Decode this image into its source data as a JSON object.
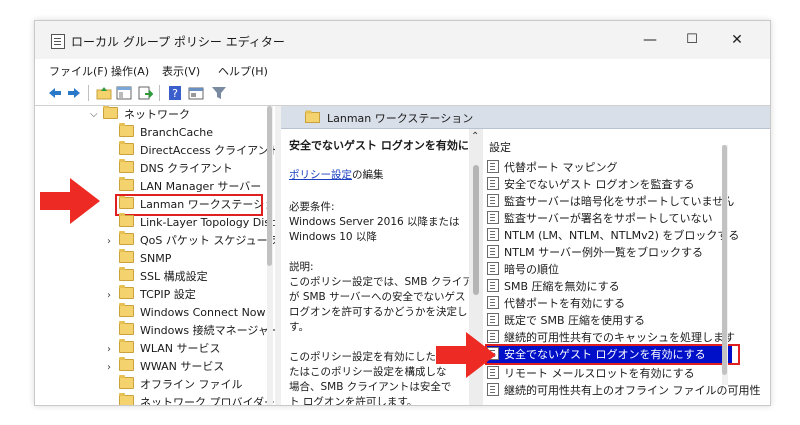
{
  "window": {
    "title": "ローカル グループ ポリシー エディター",
    "minimize": "—",
    "maximize": "☐",
    "close": "✕"
  },
  "menu": [
    "ファイル(F)",
    "操作(A)",
    "表示(V)",
    "ヘルプ(H)"
  ],
  "toolbar": {
    "icons": [
      "back-icon",
      "forward-icon",
      "folder-up-icon",
      "show-hide-tree-icon",
      "export-list-icon",
      "help-icon",
      "properties-icon",
      "filter-icon"
    ]
  },
  "tree": {
    "parent": "ネットワーク",
    "items": [
      {
        "label": "BranchCache",
        "expandable": false
      },
      {
        "label": "DirectAccess クライアント エ",
        "expandable": false
      },
      {
        "label": "DNS クライアント",
        "expandable": false
      },
      {
        "label": "LAN Manager サーバー",
        "expandable": false
      },
      {
        "label": "Lanman ワークステーション",
        "expandable": false,
        "selected": true
      },
      {
        "label": "Link-Layer Topology Disc",
        "expandable": false
      },
      {
        "label": "QoS パケット スケジューラ",
        "expandable": true
      },
      {
        "label": "SNMP",
        "expandable": false
      },
      {
        "label": "SSL 構成設定",
        "expandable": false
      },
      {
        "label": "TCPIP 設定",
        "expandable": true
      },
      {
        "label": "Windows Connect Now",
        "expandable": false
      },
      {
        "label": "Windows 接続マネージャー",
        "expandable": false
      },
      {
        "label": "WLAN サービス",
        "expandable": true
      },
      {
        "label": "WWAN サービス",
        "expandable": true
      },
      {
        "label": "オフライン ファイル",
        "expandable": false
      },
      {
        "label": "ネットワーク プロバイダー",
        "expandable": false
      }
    ]
  },
  "detail": {
    "header": "Lanman ワークステーション",
    "setting_title": "安全でないゲスト ログオンを有効にする",
    "edit_link": "ポリシー設定",
    "edit_suffix": "の編集",
    "requirements_label": "必要条件:",
    "requirements_line1": "Windows Server 2016 以降または",
    "requirements_line2": "Windows 10 以降",
    "description_label": "説明:",
    "description_lines": [
      "このポリシー設定では、SMB クライアント",
      "が SMB サーバーへの安全でないゲスト",
      "ログオンを許可するかどうかを決定しま",
      "す。",
      "",
      "このポリシー設定を有効にした場合、ま",
      "たはこのポリシー設定を構成しな",
      "場合、SMB クライアントは安全で",
      "ト ログオンを許可します。"
    ]
  },
  "list": {
    "column_header": "設定",
    "items": [
      "代替ポート マッピング",
      "安全でないゲスト ログオンを監査する",
      "監査サーバーは暗号化をサポートしていません",
      "監査サーバーが署名をサポートしていない",
      "NTLM (LM、NTLM、NTLMv2) をブロックする",
      "NTLM サーバー例外一覧をブロックする",
      "暗号の順位",
      "SMB 圧縮を無効にする",
      "代替ポートを有効にする",
      "既定で SMB 圧縮を使用する",
      "継続的可用性共有でのキャッシュを処理します",
      "安全でないゲスト ログオンを有効にする",
      "リモート メールスロットを有効にする",
      "継続的可用性共有上のオフライン ファイルの可用性"
    ],
    "selected_index": 11
  },
  "colors": {
    "selection": "#0010c8",
    "highlight_box": "#e02020",
    "arrow": "#ee2a24",
    "header_band": "#d9dfe8"
  }
}
